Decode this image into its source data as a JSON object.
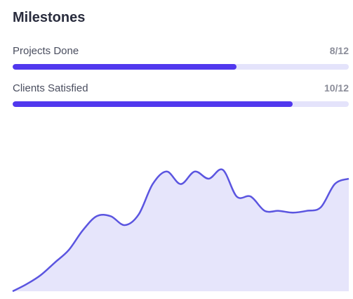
{
  "card": {
    "title": "Milestones",
    "colors": {
      "title": "#2a2d3e",
      "bar_fill": "#5138ee",
      "bar_track": "#e4e3fb",
      "chart_line": "#5b55e0",
      "chart_area": "#e6e5fb"
    }
  },
  "milestones": [
    {
      "label": "Projects Done",
      "value_text": "8/12",
      "done": 8,
      "total": 12
    },
    {
      "label": "Clients Satisfied",
      "value_text": "10/12",
      "done": 10,
      "total": 12
    }
  ],
  "chart_data": {
    "type": "area",
    "values": [
      0,
      4,
      9,
      16,
      23,
      34,
      42,
      42,
      37,
      43,
      60,
      67,
      60,
      67,
      63,
      68,
      53,
      53,
      45,
      45,
      44,
      45,
      47,
      60,
      63
    ],
    "ylim": [
      0,
      100
    ],
    "grid": false,
    "axes": false
  }
}
